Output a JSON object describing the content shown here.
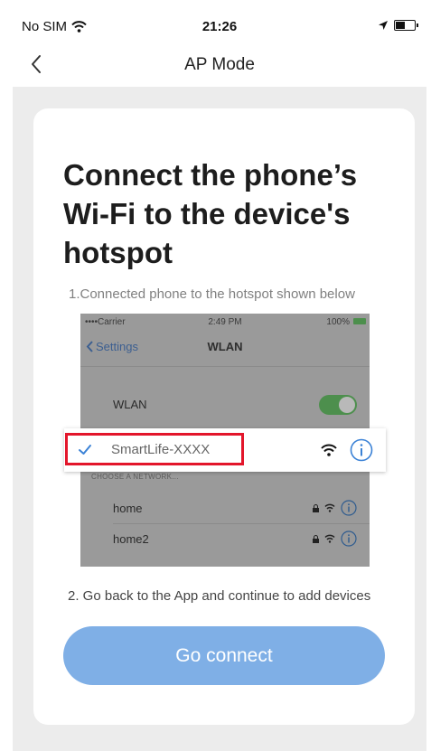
{
  "status_bar": {
    "carrier": "No SIM",
    "time": "21:26"
  },
  "nav": {
    "title": "AP Mode"
  },
  "card": {
    "heading": "Connect the phone’s Wi-Fi to the device's hotspot",
    "step1": "1.Connected phone to the hotspot shown below",
    "step2": "2. Go back to the App and continue to add devices",
    "button": "Go connect"
  },
  "illustration": {
    "status": {
      "carrier": "••••Carrier",
      "time": "2:49 PM",
      "battery": "100%"
    },
    "back_label": "Settings",
    "title": "WLAN",
    "wlan_label": "WLAN",
    "wlan_on": true,
    "connected_network": "SmartLife-XXXX",
    "choose_header": "CHOOSE A NETWORK...",
    "networks": [
      "home",
      "home2"
    ]
  },
  "colors": {
    "accent_button": "#7fafe6",
    "highlight": "#e3162b",
    "link_blue": "#3b82d6"
  }
}
